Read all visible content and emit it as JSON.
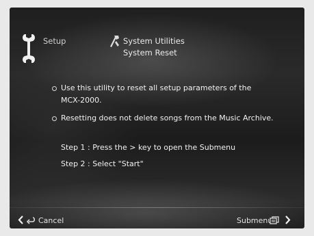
{
  "header": {
    "setup_label": "Setup",
    "title": "System Utilities",
    "subtitle": "System Reset"
  },
  "body": {
    "bullet_1_line_1": "Use this utility to reset all setup parameters of the",
    "bullet_1_line_2": "MCX-2000.",
    "bullet_2": "Resetting does not delete songs from the Music Archive.",
    "step_1": "Step 1 : Press the > key to open the Submenu",
    "step_2": "Step 2 : Select \"Start\""
  },
  "footer": {
    "cancel_label": "Cancel",
    "submenu_label": "Submenu"
  },
  "icons": {
    "setup": "wrench-icon",
    "utilities": "tools-icon",
    "back": "left-arrow-icon",
    "return": "return-icon",
    "submenu": "submenu-icon",
    "forward": "right-arrow-icon"
  }
}
